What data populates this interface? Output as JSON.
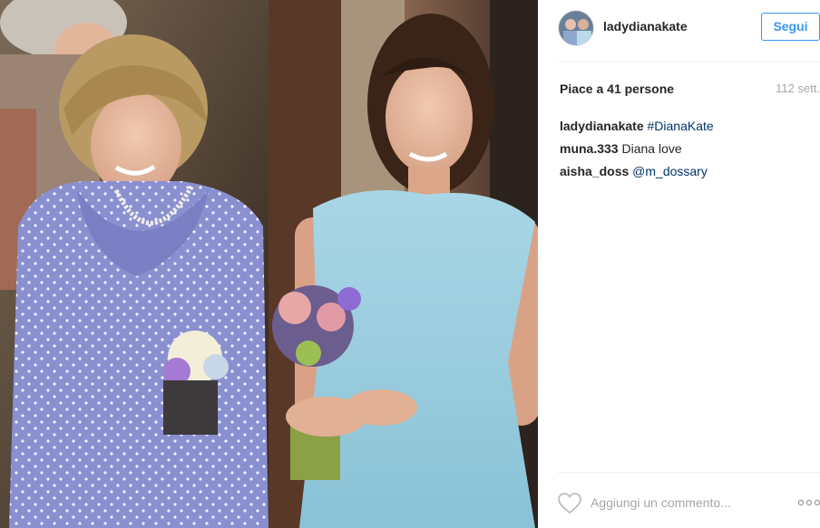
{
  "post": {
    "username": "ladydianakate",
    "follow_label": "Segui",
    "likes_text": "Piace a 41 persone",
    "time_text": "112 sett.",
    "comments": [
      {
        "user": "ladydianakate",
        "tag": "#DianaKate",
        "text": ""
      },
      {
        "user": "muna.333",
        "tag": "",
        "text": "Diana love"
      },
      {
        "user": "aisha_doss",
        "tag": "@m_dossary",
        "text": ""
      }
    ],
    "comment_placeholder": "Aggiungi un commento...",
    "icons": {
      "like": "heart-outline-icon",
      "more": "more-options-icon"
    }
  },
  "colors": {
    "accent": "#3897f0",
    "hashtag": "#003569",
    "muted": "#a5a7aa",
    "divider": "#efefef"
  }
}
